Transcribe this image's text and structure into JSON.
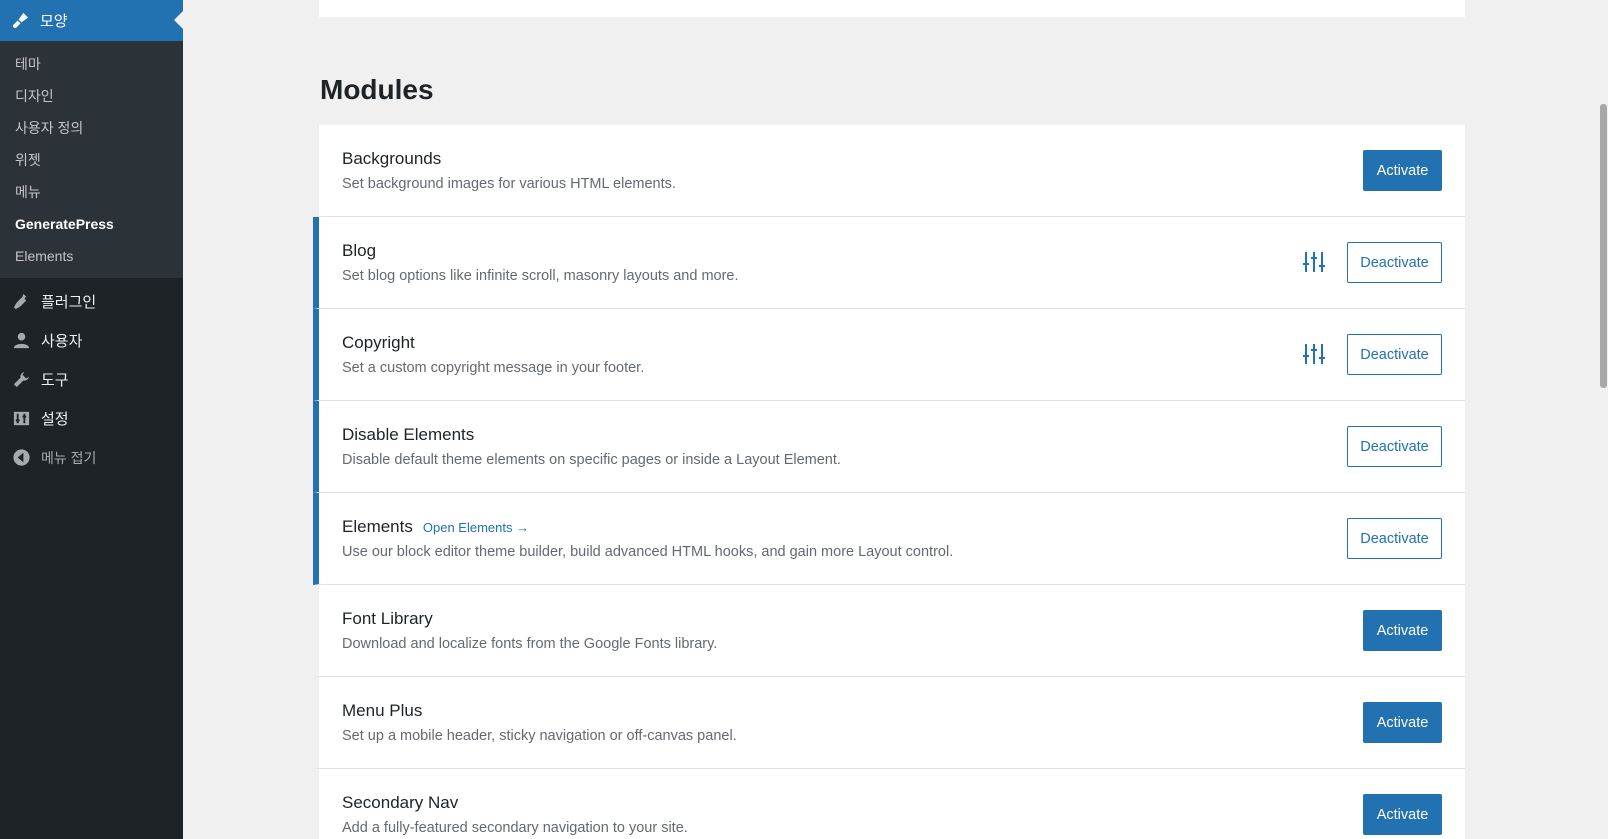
{
  "sidebar": {
    "current_menu": {
      "label": "모양",
      "icon": "paintbrush-icon"
    },
    "submenu": [
      {
        "label": "테마"
      },
      {
        "label": "디자인"
      },
      {
        "label": "사용자 정의"
      },
      {
        "label": "위젯"
      },
      {
        "label": "메뉴"
      },
      {
        "label": "GeneratePress"
      },
      {
        "label": "Elements"
      }
    ],
    "items": [
      {
        "label": "플러그인",
        "icon": "plugin-icon"
      },
      {
        "label": "사용자",
        "icon": "user-icon"
      },
      {
        "label": "도구",
        "icon": "wrench-icon"
      },
      {
        "label": "설정",
        "icon": "settings-sliders-icon"
      }
    ],
    "collapse": {
      "label": "메뉴 접기",
      "icon": "collapse-icon"
    }
  },
  "page": {
    "title": "Modules"
  },
  "colors": {
    "accent": "#2271b1",
    "sidebar_bg": "#1d2327"
  },
  "modules": [
    {
      "title": "Backgrounds",
      "desc": "Set background images for various HTML elements.",
      "action": "Activate"
    },
    {
      "title": "Blog",
      "desc": "Set blog options like infinite scroll, masonry layouts and more.",
      "action": "Deactivate"
    },
    {
      "title": "Copyright",
      "desc": "Set a custom copyright message in your footer.",
      "action": "Deactivate"
    },
    {
      "title": "Disable Elements",
      "desc": "Disable default theme elements on specific pages or inside a Layout Element.",
      "action": "Deactivate"
    },
    {
      "title": "Elements",
      "link": "Open Elements →",
      "desc": "Use our block editor theme builder, build advanced HTML hooks, and gain more Layout control.",
      "action": "Deactivate"
    },
    {
      "title": "Font Library",
      "desc": "Download and localize fonts from the Google Fonts library.",
      "action": "Activate"
    },
    {
      "title": "Menu Plus",
      "desc": "Set up a mobile header, sticky navigation or off-canvas panel.",
      "action": "Activate"
    },
    {
      "title": "Secondary Nav",
      "desc": "Add a fully-featured secondary navigation to your site.",
      "action": "Activate"
    }
  ]
}
